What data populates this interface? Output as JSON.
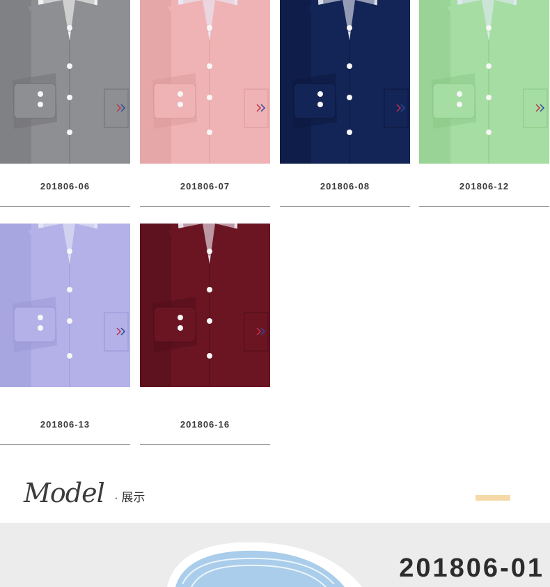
{
  "products": [
    {
      "code": "201806-06",
      "color": "#8e8f93",
      "shade": "#6f7075",
      "collar": "#f2f2f2"
    },
    {
      "code": "201806-07",
      "color": "#f0b3b5",
      "shade": "#d9999b",
      "collar": "#e8e8f4"
    },
    {
      "code": "201806-08",
      "color": "#132456",
      "shade": "#0b173c",
      "collar": "#d7dbe8"
    },
    {
      "code": "201806-12",
      "color": "#a6dda2",
      "shade": "#8ac786",
      "collar": "#dde8f0"
    },
    {
      "code": "201806-13",
      "color": "#b3b1e8",
      "shade": "#9a98d6",
      "collar": "#e3e3f4"
    },
    {
      "code": "201806-16",
      "color": "#6b1523",
      "shade": "#4f0e19",
      "collar": "#e8e0e8"
    }
  ],
  "section": {
    "title": "Model",
    "subtitle": "· 展示"
  },
  "banner": {
    "code": "201806-01",
    "collar_color": "#a9cdea"
  },
  "colors": {
    "accent": "#f5d9a8",
    "divider": "#9a9a9a",
    "text": "#3a3a3a"
  }
}
